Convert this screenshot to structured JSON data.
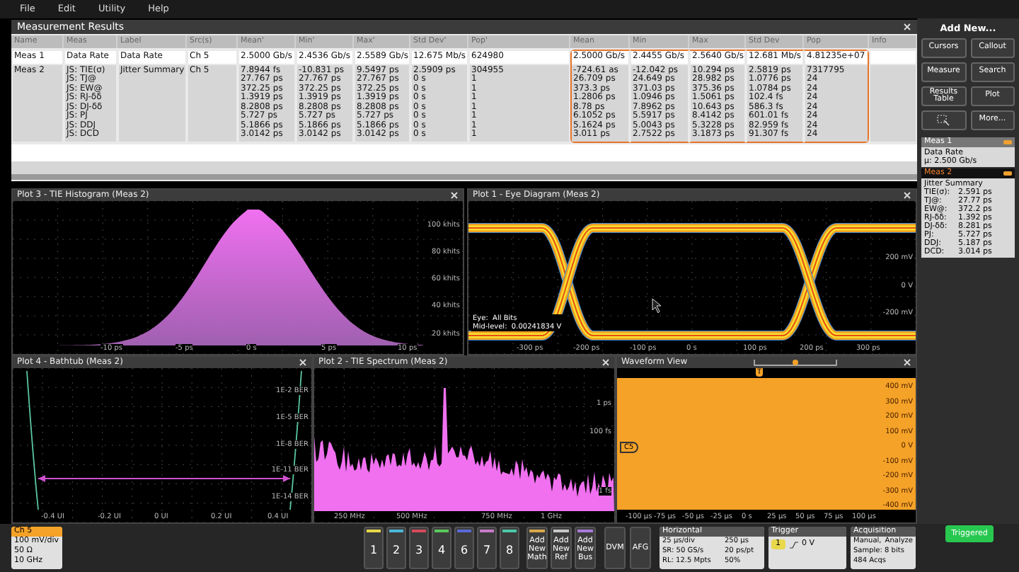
{
  "menu": [
    "File",
    "Edit",
    "Utility",
    "Help"
  ],
  "results": {
    "title": "Measurement Results",
    "columns": [
      {
        "label": "Name",
        "highlighted": false
      },
      {
        "label": "Meas",
        "highlighted": false
      },
      {
        "label": "Label",
        "highlighted": false
      },
      {
        "label": "Src(s)",
        "highlighted": false
      },
      {
        "label": "Mean'",
        "highlighted": false
      },
      {
        "label": "Min'",
        "highlighted": false
      },
      {
        "label": "Max'",
        "highlighted": false
      },
      {
        "label": "Std Dev'",
        "highlighted": false
      },
      {
        "label": "Pop'",
        "highlighted": false
      },
      {
        "label": "Mean",
        "highlighted": true
      },
      {
        "label": "Min",
        "highlighted": true
      },
      {
        "label": "Max",
        "highlighted": true
      },
      {
        "label": "Std Dev",
        "highlighted": true
      },
      {
        "label": "Pop",
        "highlighted": true
      },
      {
        "label": "Info",
        "highlighted": false
      }
    ],
    "rows": [
      {
        "cells": [
          [
            "Meas 1"
          ],
          [
            "Data Rate"
          ],
          [
            "Data Rate"
          ],
          [
            "Ch 5"
          ],
          [
            "2.5000 Gb/s"
          ],
          [
            "2.4536 Gb/s"
          ],
          [
            "2.5589 Gb/s"
          ],
          [
            "12.675 Mb/s"
          ],
          [
            "624980"
          ],
          [
            "2.5000 Gb/s"
          ],
          [
            "2.4455 Gb/s"
          ],
          [
            "2.5640 Gb/s"
          ],
          [
            "12.681 Mb/s"
          ],
          [
            "4.81235e+07"
          ]
        ]
      },
      {
        "cells": [
          [
            "Meas 2"
          ],
          [
            "JS: TIE(σ)",
            "JS: TJ@",
            "JS: EW@",
            "JS: RJ-δδ",
            "JS: DJ-δδ",
            "JS: PJ",
            "JS: DDJ",
            "JS: DCD"
          ],
          [
            "Jitter Summary"
          ],
          [
            "Ch 5"
          ],
          [
            "7.8944 fs",
            "27.767 ps",
            "372.25 ps",
            "1.3919 ps",
            "8.2808 ps",
            "5.727 ps",
            "5.1866 ps",
            "3.0142 ps"
          ],
          [
            "-10.831 ps",
            "27.767 ps",
            "372.25 ps",
            "1.3919 ps",
            "8.2808 ps",
            "5.727 ps",
            "5.1866 ps",
            "3.0142 ps"
          ],
          [
            "9.5497 ps",
            "27.767 ps",
            "372.25 ps",
            "1.3919 ps",
            "8.2808 ps",
            "5.727 ps",
            "5.1866 ps",
            "3.0142 ps"
          ],
          [
            "2.5909 ps",
            "0 s",
            "0 s",
            "0 s",
            "0 s",
            "0 s",
            "0 s",
            "0 s"
          ],
          [
            "304955",
            "1",
            "1",
            "1",
            "1",
            "1",
            "1",
            "1"
          ],
          [
            "-724.61 as",
            "26.709 ps",
            "373.3 ps",
            "1.2806 ps",
            "8.78 ps",
            "6.1052 ps",
            "5.1624 ps",
            "3.011 ps"
          ],
          [
            "-12.042 ps",
            "24.649 ps",
            "371.03 ps",
            "1.0946 ps",
            "7.8962 ps",
            "5.5917 ps",
            "5.0043 ps",
            "2.7522 ps"
          ],
          [
            "10.294 ps",
            "28.982 ps",
            "375.36 ps",
            "1.5061 ps",
            "10.643 ps",
            "8.4142 ps",
            "5.3228 ps",
            "3.1873 ps"
          ],
          [
            "2.5819 ps",
            "1.0776 ps",
            "1.0784 ps",
            "102.4 fs",
            "586.3 fs",
            "601.01 fs",
            "82.959 fs",
            "91.307 fs"
          ],
          [
            "7317795",
            "24",
            "24",
            "24",
            "24",
            "24",
            "24",
            "24"
          ]
        ]
      }
    ]
  },
  "plots": [
    {
      "kind": "histogram",
      "title": "Plot 3 - TIE Histogram (Meas 2)",
      "yticks": [
        "100 khits",
        "80 khits",
        "60 khits",
        "40 khits",
        "20 khits"
      ],
      "xticks": [
        "-10 ps",
        "-5 ps",
        "0 s",
        "5 ps",
        "10 ps"
      ]
    },
    {
      "kind": "eye",
      "title": "Plot 1 - Eye Diagram (Meas 2)",
      "yticks": [
        "200 mV",
        "0 V",
        "-200 mV"
      ],
      "xticks": [
        "-300 ps",
        "-200 ps",
        "-100 ps",
        "0 s",
        "100 ps",
        "200 ps",
        "300 ps"
      ],
      "notes": [
        "Eye:  All Bits",
        "Mid-level:  0.00241834 V"
      ]
    },
    {
      "kind": "bathtub",
      "title": "Plot 4 - Bathtub (Meas 2)",
      "yticks": [
        "1E-2 BER",
        "1E-5 BER",
        "1E-8 BER",
        "1E-11 BER",
        "1E-14 BER"
      ],
      "xticks": [
        "-0.4 UI",
        "-0.2 UI",
        "0 UI",
        "0.2 UI",
        "0.4 UI"
      ]
    },
    {
      "kind": "spectrum",
      "title": "Plot 2 - TIE Spectrum (Meas 2)",
      "yticks": [
        "1 ps",
        "100 fs",
        "1 fs"
      ],
      "xticks": [
        "250 MHz",
        "500 MHz",
        "750 MHz",
        "1 GHz"
      ]
    },
    {
      "kind": "waveform",
      "title": "Waveform View",
      "marker": "C5",
      "trigger_marker": "T",
      "yticks": [
        "400 mV",
        "300 mV",
        "200 mV",
        "100 mV",
        "0 V",
        "-100 mV",
        "-200 mV",
        "-300 mV",
        "-400 mV"
      ],
      "xticks": [
        "-100 µs",
        "-75 µs",
        "-50 µs",
        "-25 µs",
        "0 s",
        "25 µs",
        "50 µs",
        "75 µs",
        "100 µs"
      ]
    }
  ],
  "sidebar": {
    "title": "Add New...",
    "buttons": [
      {
        "kind": "text",
        "label": "Cursors"
      },
      {
        "kind": "text",
        "label": "Callout"
      },
      {
        "kind": "text",
        "label": "Measure"
      },
      {
        "kind": "text",
        "label": "Search"
      },
      {
        "kind": "text",
        "label": "Results Table"
      },
      {
        "kind": "text",
        "label": "Plot"
      },
      {
        "kind": "icon"
      },
      {
        "kind": "text",
        "label": "More..."
      }
    ],
    "meas": [
      {
        "title": "Meas 1",
        "selected": false,
        "subtitle": "Data Rate",
        "lines": [
          [
            "µ: 2.500 Gb/s"
          ]
        ]
      },
      {
        "title": "Meas 2",
        "selected": true,
        "subtitle": "Jitter Summary",
        "lines": [
          [
            "TIE(σ):",
            "2.591 ps"
          ],
          [
            "TJ@:",
            "27.77 ps"
          ],
          [
            "EW@:",
            "372.2 ps"
          ],
          [
            "RJ-δδ:",
            "1.392 ps"
          ],
          [
            "DJ-δδ:",
            "8.281 ps"
          ],
          [
            "PJ:",
            "5.727 ps"
          ],
          [
            "DDJ:",
            "5.187 ps"
          ],
          [
            "DCD:",
            "3.014 ps"
          ]
        ]
      }
    ]
  },
  "bottom": {
    "channel": {
      "title": "Ch 5",
      "lines": [
        "100 mV/div",
        "50 Ω",
        "10 GHz"
      ]
    },
    "channels": [
      {
        "label": "1",
        "color": "#e8d84a"
      },
      {
        "label": "2",
        "color": "#4ab8d8"
      },
      {
        "label": "3",
        "color": "#d84a5a"
      },
      {
        "label": "4",
        "color": "#5ac85a"
      },
      {
        "label": "6",
        "color": "#5a6ad8"
      },
      {
        "label": "7",
        "color": "#c87ac8"
      },
      {
        "label": "8",
        "color": "#4ac8a8"
      }
    ],
    "add": [
      {
        "label": "Add New Math",
        "color": "#d8a84a"
      },
      {
        "label": "Add New Ref",
        "color": "#c8c8c8"
      },
      {
        "label": "Add New Bus",
        "color": "#a87ad8"
      }
    ],
    "tools": [
      "DVM",
      "AFG"
    ],
    "horizontal": {
      "title": "Horizontal",
      "items": [
        "25 µs/div",
        "250 µs",
        "SR: 50 GS/s",
        "20 ps/pt",
        "RL: 12.5 Mpts",
        "50%"
      ]
    },
    "trigger": {
      "title": "Trigger",
      "source": "1",
      "level": "0 V"
    },
    "acquisition": {
      "title": "Acquisition",
      "items": [
        "Manual,",
        "Analyze",
        "Sample: 8 bits",
        "484 Acqs"
      ]
    },
    "status": "Triggered"
  }
}
